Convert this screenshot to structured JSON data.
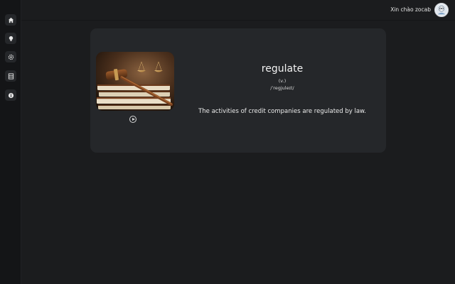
{
  "sidebar": {
    "items": [
      {
        "name": "home",
        "icon": "home-icon"
      },
      {
        "name": "ideas",
        "icon": "lightbulb-icon"
      },
      {
        "name": "settings",
        "icon": "gear-icon"
      },
      {
        "name": "vocabulary",
        "icon": "list-icon"
      },
      {
        "name": "info",
        "icon": "info-icon"
      }
    ]
  },
  "header": {
    "greeting": "Xin chào zocab",
    "avatar_icon": "user-avatar-icon"
  },
  "card": {
    "word": "regulate",
    "part_of_speech": "(v.)",
    "pronunciation": "/ˈregjuleɪt/",
    "example": "The activities of credit companies are regulated by law.",
    "image_icon": "gavel-scales-image",
    "audio_icon": "play-icon"
  },
  "colors": {
    "background": "#1b1c1e",
    "sidebar": "#141517",
    "card": "#25272a"
  }
}
